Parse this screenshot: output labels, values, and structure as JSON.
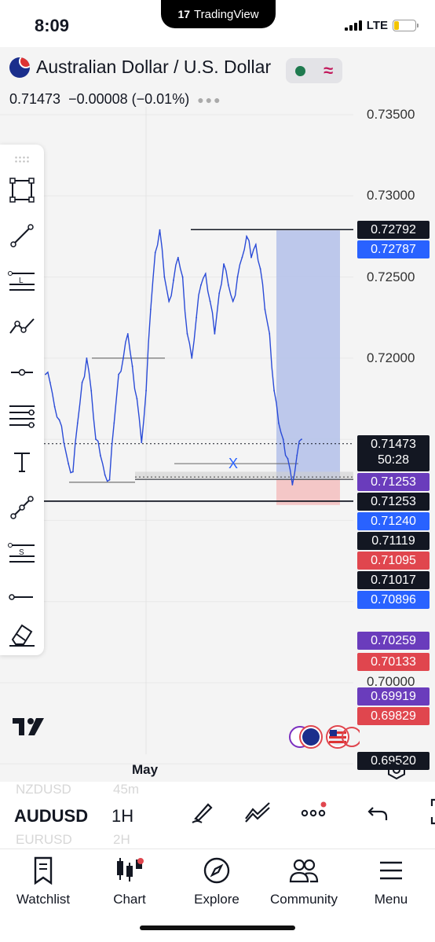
{
  "status_bar": {
    "time": "8:09",
    "network": "LTE",
    "app_banner": "TradingView"
  },
  "header": {
    "symbol_name": "Australian Dollar / U.S. Dollar",
    "price": "0.71473",
    "change": "−0.00008 (−0.01%)"
  },
  "colors": {
    "accent_blue": "#2962ff",
    "series_line": "#2a4bd7",
    "long_zone": "#b9c5ea",
    "stop_zone": "#f3c4c4",
    "label_black": "#131722",
    "label_blue": "#2962ff",
    "label_purple": "#6a3cbc",
    "label_red": "#e0464e"
  },
  "chart_data": {
    "type": "line",
    "series": [
      {
        "values": [
          0.719,
          0.7185,
          0.717,
          0.7162,
          0.7148,
          0.7135,
          0.713,
          0.716,
          0.7185,
          0.72,
          0.718,
          0.715,
          0.714,
          0.7128,
          0.7125,
          0.716,
          0.719,
          0.72,
          0.7215,
          0.7195,
          0.7175,
          0.7148,
          0.718,
          0.723,
          0.7265,
          0.7279,
          0.725,
          0.7235,
          0.7248,
          0.7262,
          0.725,
          0.7215,
          0.72,
          0.7225,
          0.7245,
          0.7252,
          0.7235,
          0.7215,
          0.724,
          0.7258,
          0.7245,
          0.7235,
          0.725,
          0.7262,
          0.7275,
          0.7262,
          0.727,
          0.7255,
          0.723,
          0.7215,
          0.718,
          0.716,
          0.715,
          0.7138,
          0.7122,
          0.714,
          0.715
        ]
      }
    ],
    "ylim": [
      0.694,
      0.7375
    ],
    "y_ticks": [
      "0.73500",
      "0.73000",
      "0.72500",
      "0.72000",
      "0.70000"
    ],
    "x_ticks": [
      "May"
    ],
    "annotations": {
      "range_marker": "X"
    }
  },
  "price_labels": [
    {
      "value": "0.72792",
      "style": "black",
      "level": 0.72792
    },
    {
      "value": "0.72787",
      "style": "blue",
      "level": 0.72787
    },
    {
      "value": "0.71473",
      "sub": "50:28",
      "style": "black",
      "level": 0.71473
    },
    {
      "value": "0.71253",
      "style": "purple",
      "level": 0.71253
    },
    {
      "value": "0.71253",
      "style": "black",
      "level": 0.71253
    },
    {
      "value": "0.71240",
      "style": "blue",
      "level": 0.7124
    },
    {
      "value": "0.71119",
      "style": "black",
      "level": 0.71119
    },
    {
      "value": "0.71095",
      "style": "red",
      "level": 0.71095
    },
    {
      "value": "0.71017",
      "style": "black",
      "level": 0.71017
    },
    {
      "value": "0.70896",
      "style": "blue",
      "level": 0.70896
    },
    {
      "value": "0.70259",
      "style": "purple",
      "level": 0.70259
    },
    {
      "value": "0.70133",
      "style": "red",
      "level": 0.70133
    },
    {
      "value": "0.69919",
      "style": "purple",
      "level": 0.69919
    },
    {
      "value": "0.69829",
      "style": "red",
      "level": 0.69829
    },
    {
      "value": "0.69520",
      "style": "black",
      "level": 0.6952
    }
  ],
  "drawing_tools": [
    "rectangle-icon",
    "trend-line-icon",
    "horizontal-line-label-icon",
    "path-icon",
    "horizontal-ray-icon",
    "parallel-lines-icon",
    "text-icon",
    "polyline-icon",
    "horizontal-line-s-icon",
    "ray-icon",
    "eraser-icon"
  ],
  "symbol_picker": {
    "prev_symbol": "NZDUSD",
    "current_symbol": "AUDUSD",
    "next_symbol": "EURUSD",
    "prev_interval": "45m",
    "current_interval": "1H",
    "next_interval": "2H"
  },
  "tabs": [
    {
      "label": "Watchlist",
      "icon": "watchlist-icon"
    },
    {
      "label": "Chart",
      "icon": "chart-icon"
    },
    {
      "label": "Explore",
      "icon": "explore-icon"
    },
    {
      "label": "Community",
      "icon": "community-icon"
    },
    {
      "label": "Menu",
      "icon": "menu-icon"
    }
  ]
}
